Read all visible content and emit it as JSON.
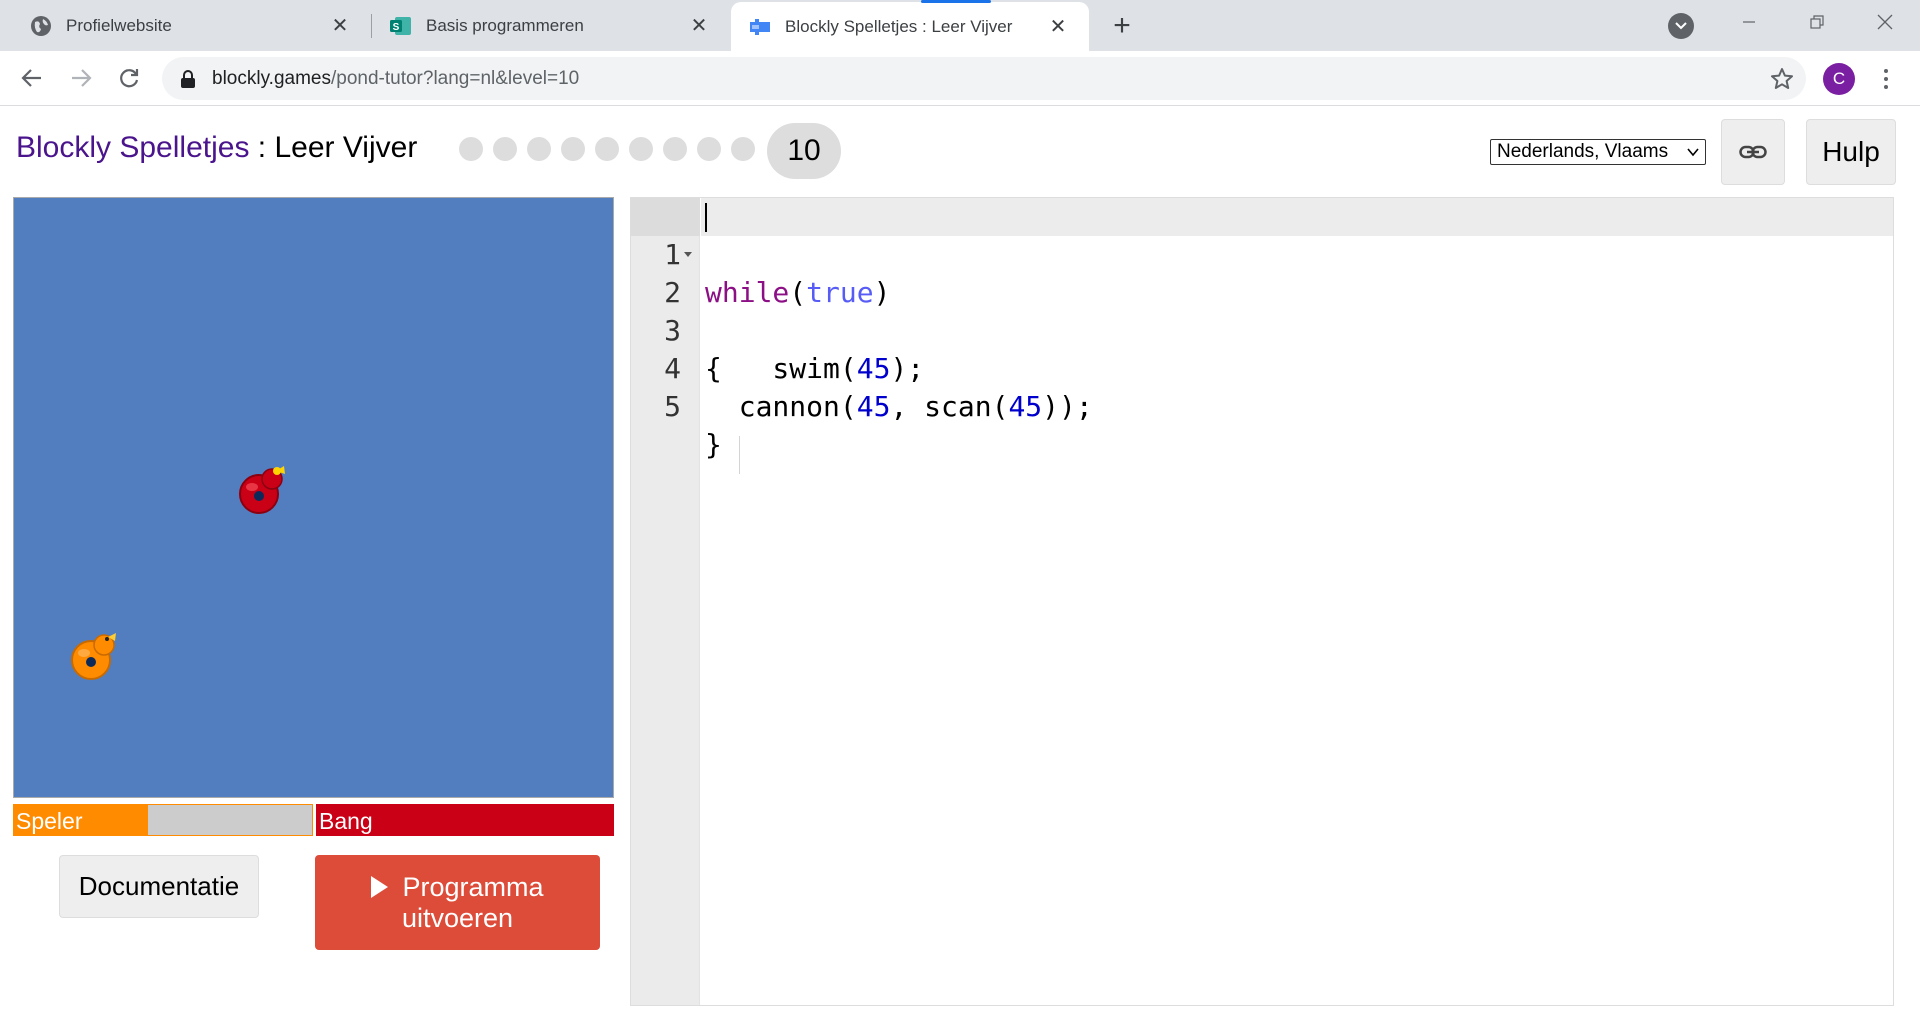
{
  "browser": {
    "tabs": [
      {
        "title": "Profielwebsite",
        "icon": "globe-icon",
        "active": false
      },
      {
        "title": "Basis programmeren",
        "icon": "sway-icon",
        "active": false
      },
      {
        "title": "Blockly Spelletjes : Leer Vijver",
        "icon": "blockly-icon",
        "active": true
      }
    ],
    "url_host": "blockly.games",
    "url_rest": "/pond-tutor?lang=nl&level=10",
    "profile_initial": "C",
    "profile_color": "#7b1fa2",
    "new_tab_label": "+"
  },
  "header": {
    "game_name": "Blockly Spelletjes",
    "separator": " : ",
    "level_name": "Leer Vijver",
    "levels_total": 10,
    "level_current": "10",
    "language": "Nederlands, Vlaams",
    "help_label": "Hulp"
  },
  "pond": {
    "background_color": "#527dbf",
    "ducks": [
      {
        "name": "Speler",
        "color": "#ff8b00"
      },
      {
        "name": "Bang",
        "color": "#c90016"
      }
    ]
  },
  "health": {
    "player": {
      "name": "Speler",
      "fraction": 0.45,
      "color": "#ff8b00"
    },
    "opponent": {
      "name": "Bang",
      "fraction": 1.0,
      "color": "#c90016"
    }
  },
  "buttons": {
    "documentation": "Documentatie",
    "run_line1": "Programma",
    "run_line2": "uitvoeren"
  },
  "editor": {
    "line_numbers": [
      "1",
      "2",
      "3",
      "4",
      "5"
    ],
    "lines": [
      "while(true)",
      "{",
      "    swim(45);",
      "  cannon(45, scan(45));",
      "}"
    ]
  }
}
